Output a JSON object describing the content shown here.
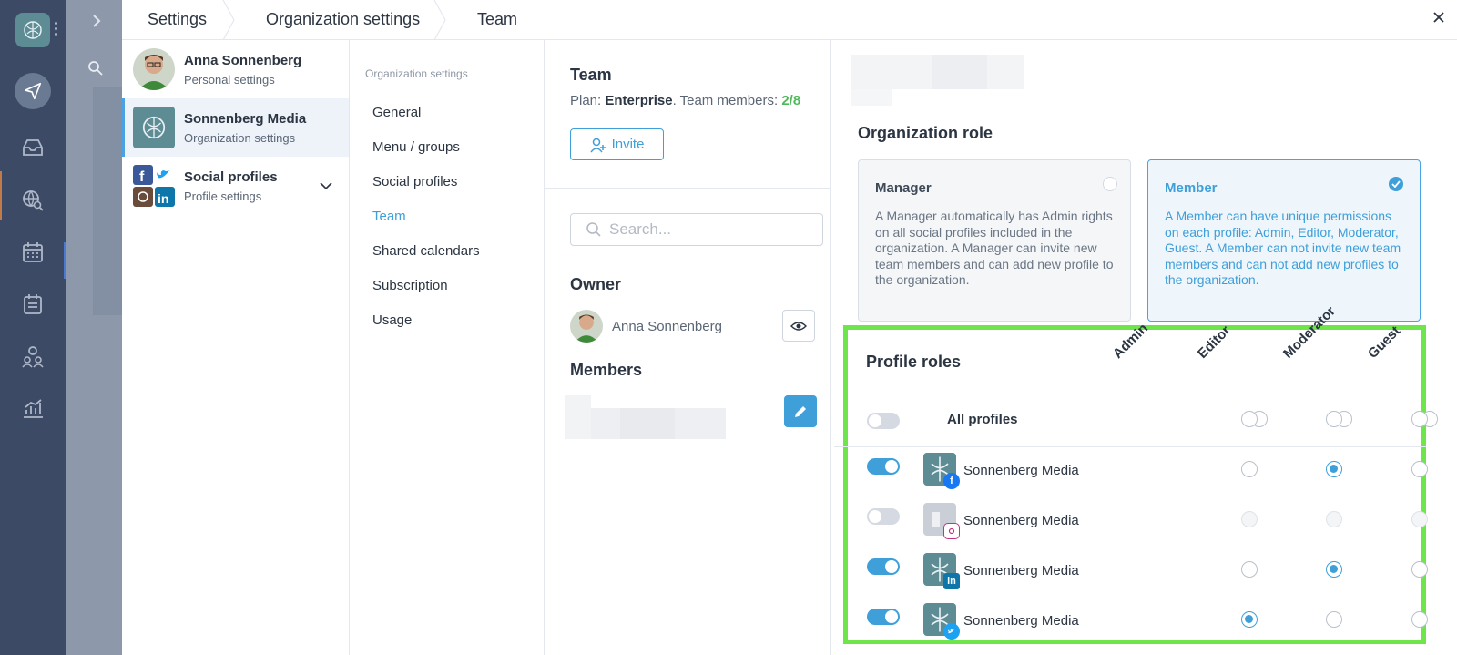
{
  "breadcrumb": [
    "Settings",
    "Organization settings",
    "Team"
  ],
  "accounts": [
    {
      "name": "Anna Sonnenberg",
      "sub": "Personal settings"
    },
    {
      "name": "Sonnenberg Media",
      "sub": "Organization settings"
    },
    {
      "name": "Social profiles",
      "sub": "Profile settings"
    }
  ],
  "nav": {
    "heading": "Organization settings",
    "items": [
      "General",
      "Menu / groups",
      "Social profiles",
      "Team",
      "Shared calendars",
      "Subscription",
      "Usage"
    ]
  },
  "team": {
    "title": "Team",
    "plan_prefix": "Plan: ",
    "plan_name": "Enterprise",
    "members_prefix": ". Team members: ",
    "members_count": "2/8",
    "invite_label": "Invite",
    "search_placeholder": "Search...",
    "owner_label": "Owner",
    "owner_name": "Anna Sonnenberg",
    "members_label": "Members"
  },
  "roles": {
    "org_role_title": "Organization role",
    "manager": {
      "title": "Manager",
      "desc": "A Manager automatically has Admin rights on all social profiles included in the organization. A Manager can invite new team members and can add new profile to the organization."
    },
    "member": {
      "title": "Member",
      "desc": "A Member can have unique permissions on each profile: Admin, Editor, Moderator, Guest. A Member can not invite new team members and can not add new profiles to the organization."
    },
    "profile_roles_title": "Profile roles",
    "columns": [
      "Admin",
      "Editor",
      "Moderator",
      "Guest"
    ],
    "all_profiles_label": "All profiles",
    "profiles": [
      {
        "name": "Sonnenberg Media",
        "network": "facebook",
        "enabled": true,
        "selected": 1
      },
      {
        "name": "Sonnenberg Media",
        "network": "instagram",
        "enabled": false,
        "selected": -1
      },
      {
        "name": "Sonnenberg Media",
        "network": "linkedin",
        "enabled": true,
        "selected": 1
      },
      {
        "name": "Sonnenberg Media",
        "network": "twitter",
        "enabled": true,
        "selected": 0
      }
    ]
  },
  "colors": {
    "accent": "#3e9fd9",
    "highlight": "#6ee54a",
    "green_text": "#4fb85a",
    "rail": "#3c4a65"
  }
}
